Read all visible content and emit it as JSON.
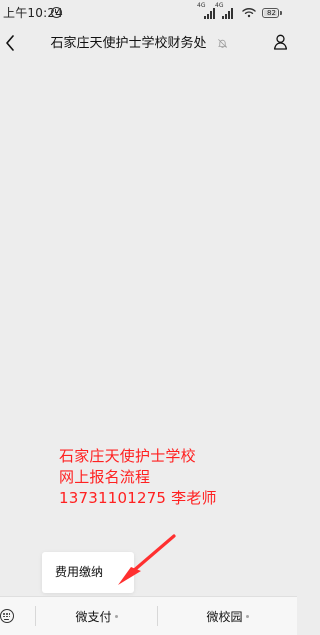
{
  "status_bar": {
    "time": "上午10:24",
    "battery": "82",
    "signal_tag": "4G"
  },
  "header": {
    "title": "石家庄天使护士学校财务处"
  },
  "overlay": {
    "lines": [
      "石家庄天使护士学校",
      "网上报名流程",
      "13731101275 李老师"
    ]
  },
  "popup": {
    "items": [
      {
        "label": "费用缴纳"
      }
    ]
  },
  "bottom_menu": {
    "items": [
      {
        "label": "微支付"
      },
      {
        "label": "微校园"
      }
    ]
  },
  "colors": {
    "background": "#ededed",
    "overlay_text": "#ff2121",
    "arrow": "#ff3030"
  }
}
